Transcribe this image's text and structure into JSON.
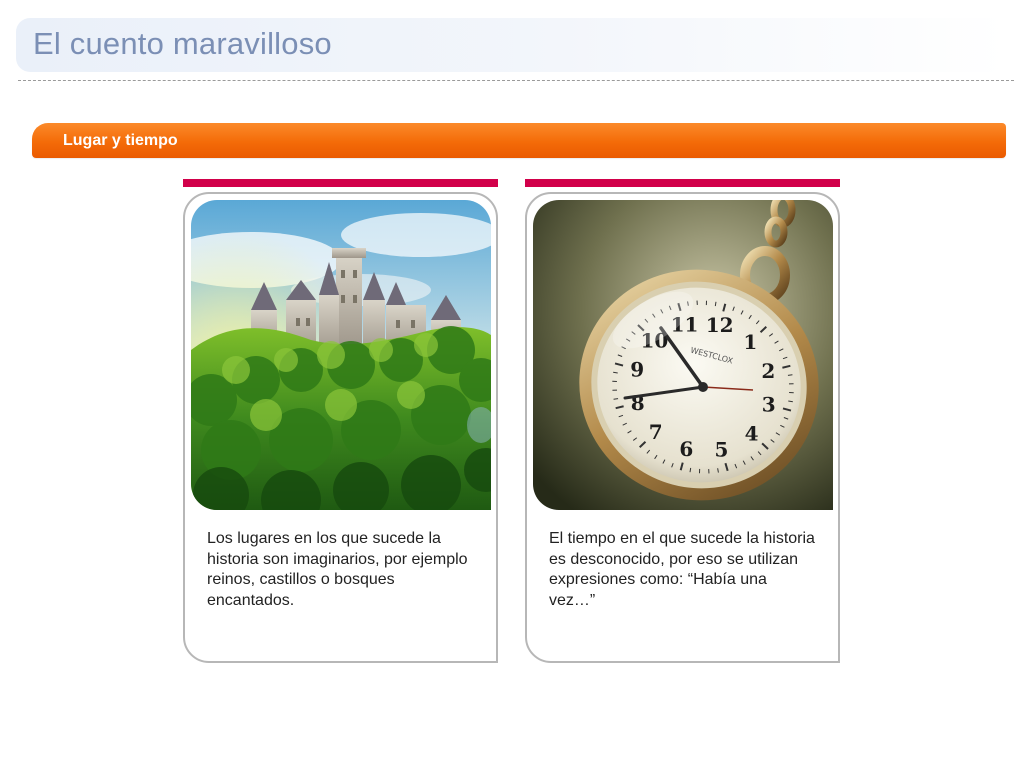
{
  "header": {
    "title": "El cuento maravilloso"
  },
  "section": {
    "label": "Lugar y tiempo"
  },
  "cards": [
    {
      "image": "castle-on-green-hill",
      "text": "Los lugares en los que sucede la historia son imaginarios, por ejemplo reinos, castillos o bosques encantados."
    },
    {
      "image": "pocket-watch",
      "text": "El tiempo en el que sucede la historia es desconocido, por eso se utilizan expresiones como: “Había una vez…”"
    }
  ],
  "watch_numerals": [
    "12",
    "1",
    "2",
    "3",
    "4",
    "5",
    "6",
    "7",
    "8",
    "9",
    "10",
    "11"
  ],
  "watch_brand": "WESTCLOX",
  "colors": {
    "title": "#7b8fb5",
    "section_bar": "#f46b08",
    "card_accent": "#d1004a",
    "card_border": "#b7b7b7"
  }
}
